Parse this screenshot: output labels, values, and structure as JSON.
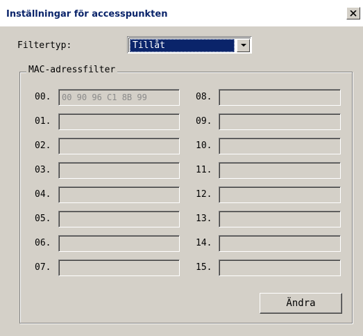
{
  "window": {
    "title": "Inställningar för accesspunkten",
    "close_icon": "close-icon"
  },
  "filter": {
    "label": "Filtertyp:",
    "value": "Tillåt",
    "dropdown_icon": "chevron-down-icon"
  },
  "mac_filter": {
    "group_label": "MAC-adressfilter",
    "entries": [
      {
        "label": "00.",
        "value": "00 90 96 C1 8B 99"
      },
      {
        "label": "01.",
        "value": ""
      },
      {
        "label": "02.",
        "value": ""
      },
      {
        "label": "03.",
        "value": ""
      },
      {
        "label": "04.",
        "value": ""
      },
      {
        "label": "05.",
        "value": ""
      },
      {
        "label": "06.",
        "value": ""
      },
      {
        "label": "07.",
        "value": ""
      },
      {
        "label": "08.",
        "value": ""
      },
      {
        "label": "09.",
        "value": ""
      },
      {
        "label": "10.",
        "value": ""
      },
      {
        "label": "11.",
        "value": ""
      },
      {
        "label": "12.",
        "value": ""
      },
      {
        "label": "13.",
        "value": ""
      },
      {
        "label": "14.",
        "value": ""
      },
      {
        "label": "15.",
        "value": ""
      }
    ]
  },
  "buttons": {
    "change_label": "Ändra"
  },
  "colors": {
    "title_text": "#0a246a",
    "selection": "#0a246a",
    "face": "#d4d0c8"
  }
}
